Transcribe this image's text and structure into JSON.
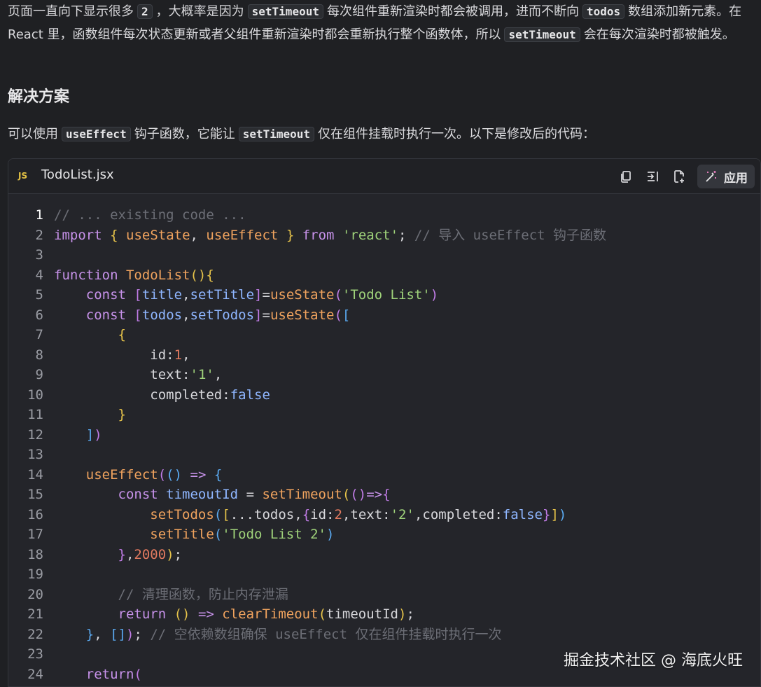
{
  "intro": {
    "p1_a": "页面一直向下显示很多",
    "p1_code1": "2",
    "p1_b": "，大概率是因为",
    "p1_code2": "setTimeout",
    "p1_c": "每次组件重新渲染时都会被调用，进而不断向",
    "p1_code3": "todos",
    "p1_d": "数组添加新元素。在 React 里，函数组件每次状态更新或者父组件重新渲染时都会重新执行整个函数体，所以",
    "p1_code4": "setTimeout",
    "p1_e": "会在每次渲染时都被触发。"
  },
  "heading": "解决方案",
  "p2": {
    "a": "可以使用",
    "code1": "useEffect",
    "b": "钩子函数，它能让",
    "code2": "setTimeout",
    "c": "仅在组件挂载时执行一次。以下是修改后的代码："
  },
  "code_block": {
    "lang": "JS",
    "file_name": "TodoList.jsx",
    "apply_label": "应用",
    "icons": [
      "copy-icon",
      "insert-icon",
      "new-file-icon",
      "magic-wand-icon"
    ],
    "line_numbers": [
      "1",
      "2",
      "3",
      "4",
      "5",
      "6",
      "7",
      "8",
      "9",
      "10",
      "11",
      "12",
      "13",
      "14",
      "15",
      "16",
      "17",
      "18",
      "19",
      "20",
      "21",
      "22",
      "23",
      "24"
    ]
  },
  "watermark": "掘金技术社区 @ 海底火旺"
}
